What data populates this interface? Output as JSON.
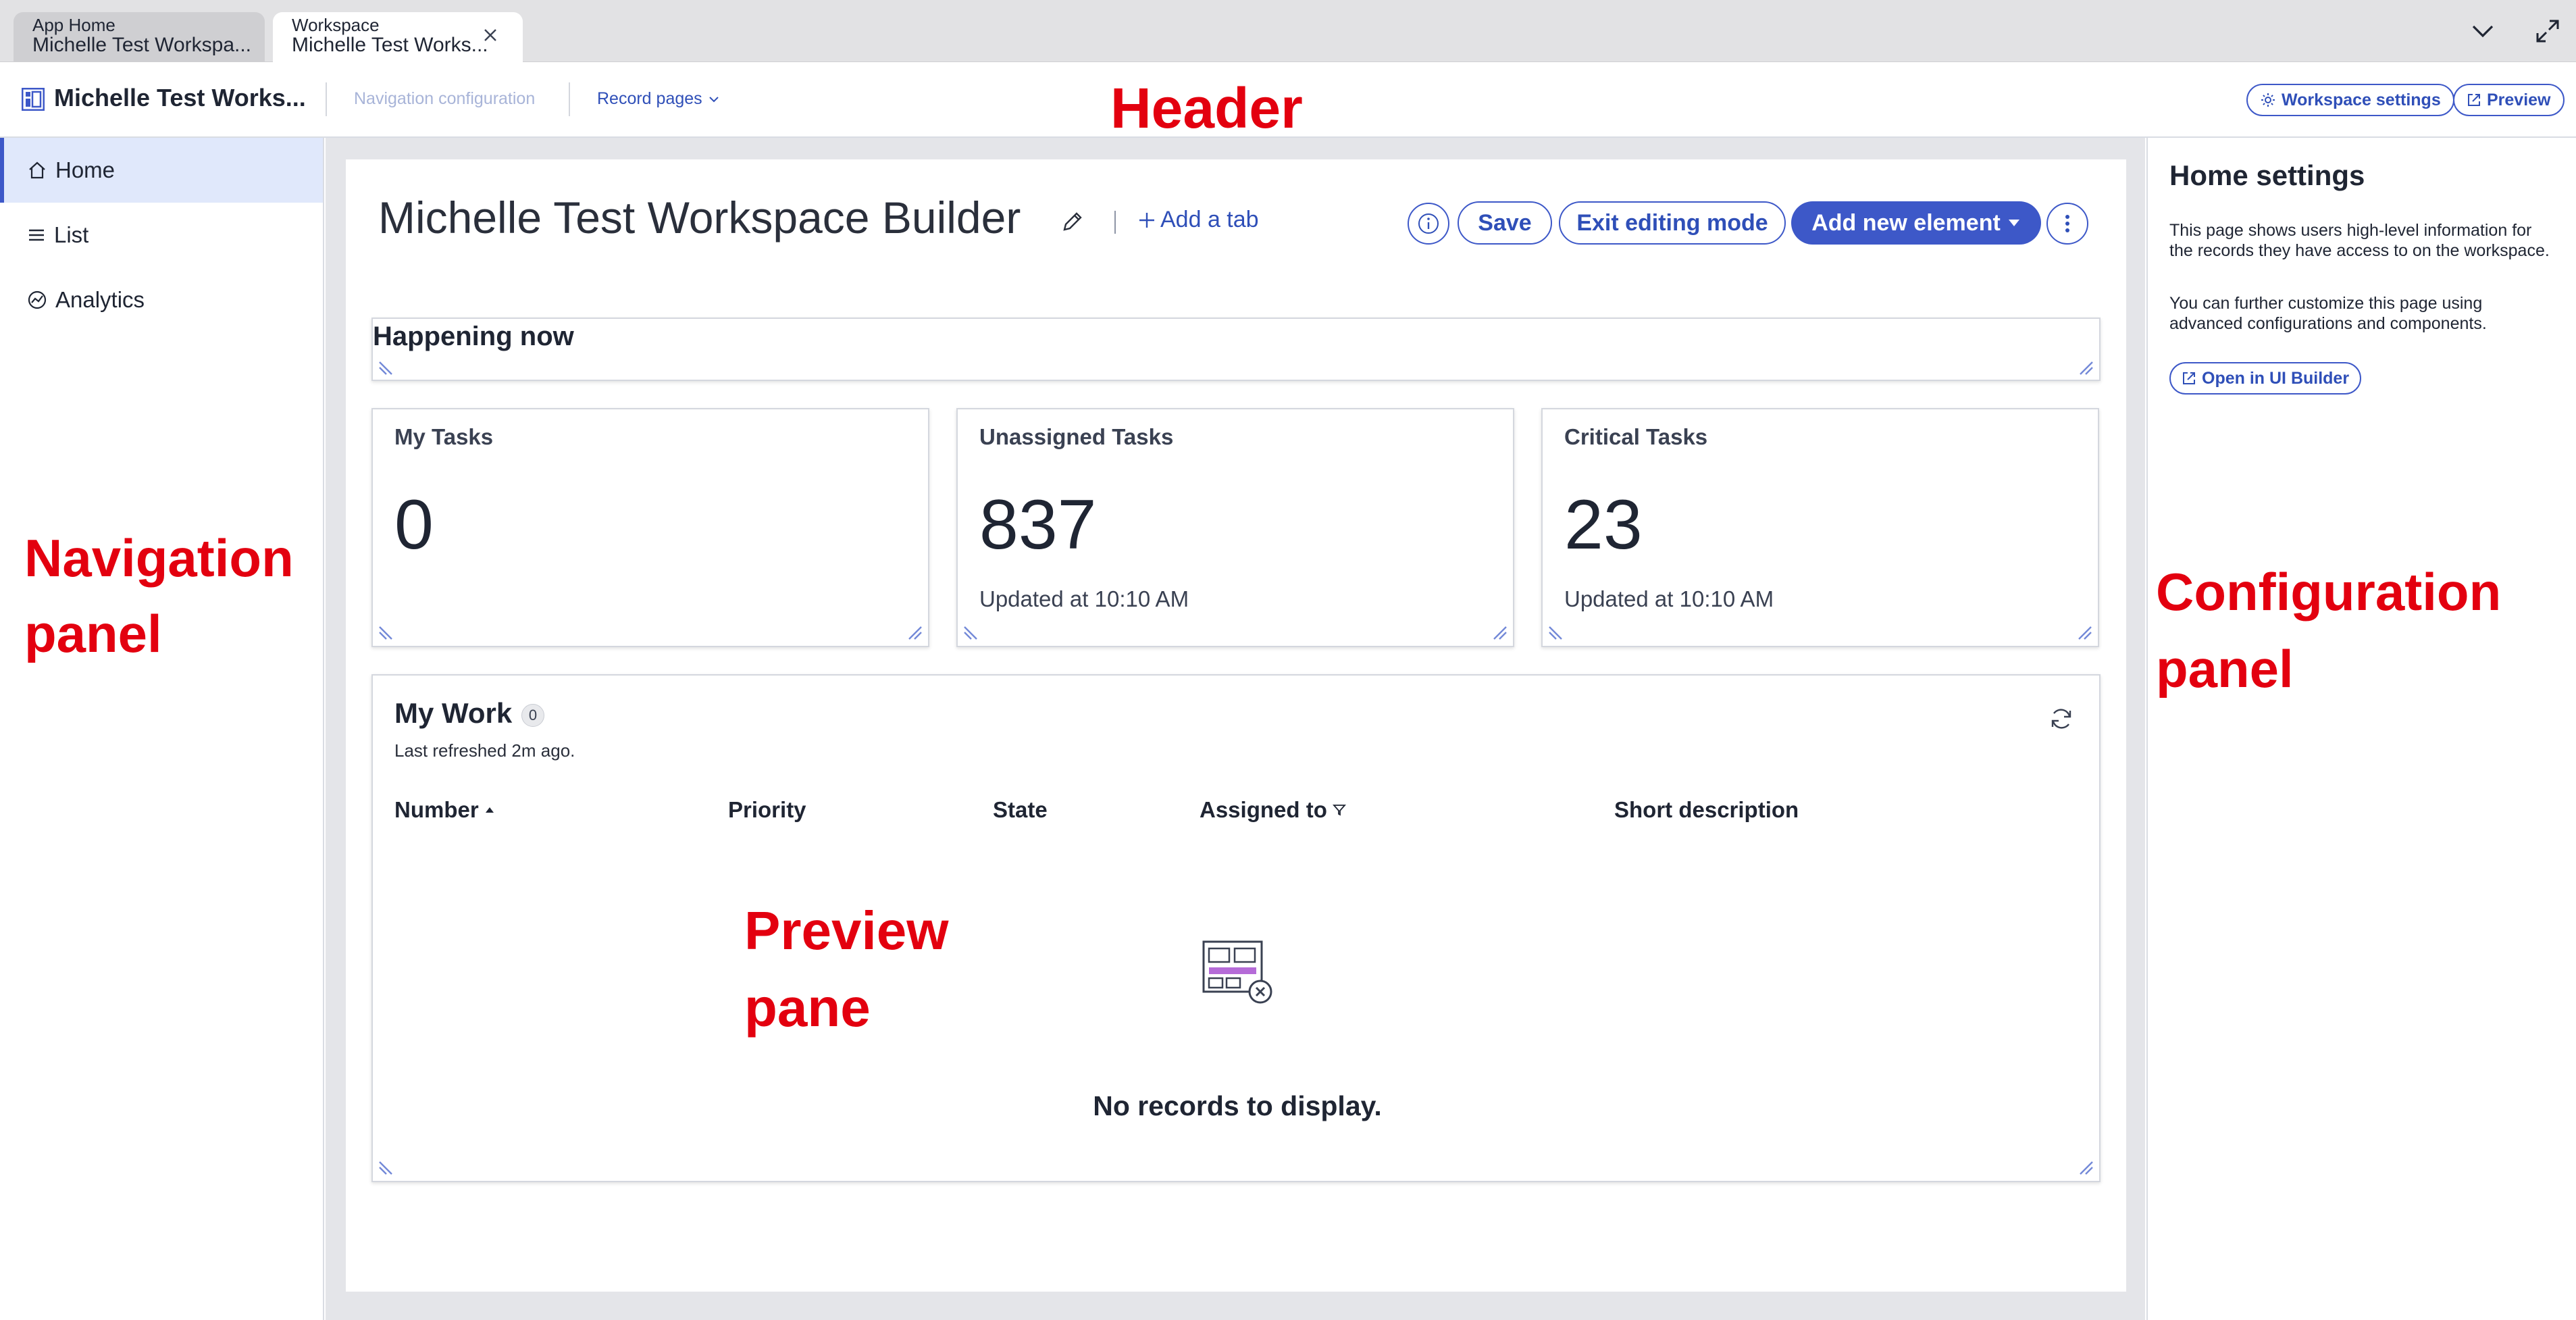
{
  "tabs": [
    {
      "title": "App Home",
      "subtitle": "Michelle Test Workspa..."
    },
    {
      "title": "Workspace",
      "subtitle": "Michelle Test Works..."
    }
  ],
  "header": {
    "app_title": "Michelle Test Works...",
    "navigation_configuration": "Navigation configuration",
    "record_pages": "Record pages",
    "workspace_settings": "Workspace settings",
    "preview": "Preview"
  },
  "nav": {
    "items": [
      {
        "label": "Home",
        "icon": "home-icon",
        "selected": true
      },
      {
        "label": "List",
        "icon": "list-icon",
        "selected": false
      },
      {
        "label": "Analytics",
        "icon": "analytics-icon",
        "selected": false
      }
    ]
  },
  "page": {
    "title": "Michelle Test Workspace Builder",
    "add_tab": "Add a tab",
    "save": "Save",
    "exit_editing": "Exit editing mode",
    "add_element": "Add new element"
  },
  "happening": {
    "title": "Happening now"
  },
  "stats": [
    {
      "label": "My Tasks",
      "value": "0",
      "updated": ""
    },
    {
      "label": "Unassigned Tasks",
      "value": "837",
      "updated": "Updated at 10:10 AM"
    },
    {
      "label": "Critical Tasks",
      "value": "23",
      "updated": "Updated at 10:10 AM"
    }
  ],
  "my_work": {
    "title": "My Work",
    "count": "0",
    "refreshed": "Last refreshed 2m ago.",
    "columns": [
      "Number",
      "Priority",
      "State",
      "Assigned to",
      "Short description"
    ],
    "empty": "No records to display."
  },
  "config": {
    "title": "Home settings",
    "text1": "This page shows users high-level information for the records they have access to on the workspace.",
    "text2": "You can further customize this page using advanced configurations and components.",
    "open_ui_builder": "Open in UI Builder"
  },
  "annotations": {
    "header": "Header",
    "navigation_line1": "Navigation",
    "navigation_line2": "panel",
    "preview_line1": "Preview",
    "preview_line2": "pane",
    "config_line1": "Configuration",
    "config_line2": "panel"
  },
  "colors": {
    "accent": "#3d58c8",
    "annotation": "#e3000f",
    "nav_selected": "#e0e8fb"
  }
}
